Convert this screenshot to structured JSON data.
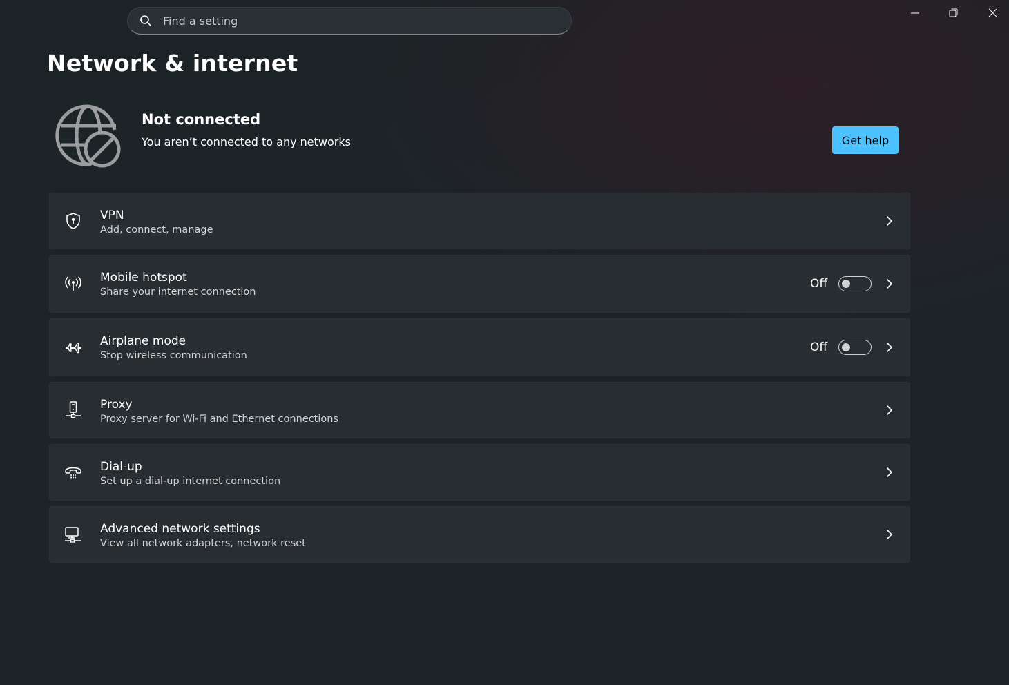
{
  "search": {
    "placeholder": "Find a setting",
    "icon": "search-icon"
  },
  "window_controls": {
    "minimize_icon": "minimize-icon",
    "restore_icon": "restore-icon",
    "close_icon": "close-icon"
  },
  "page": {
    "title": "Network & internet"
  },
  "status": {
    "icon": "globe-blocked-icon",
    "title": "Not connected",
    "subtitle": "You aren’t connected to any networks",
    "help_label": "Get help"
  },
  "accent_color": "#4cc2ff",
  "items": [
    {
      "icon": "vpn-shield-icon",
      "title": "VPN",
      "subtitle": "Add, connect, manage"
    },
    {
      "icon": "hotspot-icon",
      "title": "Mobile hotspot",
      "subtitle": "Share your internet connection",
      "toggle_label": "Off",
      "toggle_on": false
    },
    {
      "icon": "airplane-icon",
      "title": "Airplane mode",
      "subtitle": "Stop wireless communication",
      "toggle_label": "Off",
      "toggle_on": false
    },
    {
      "icon": "proxy-icon",
      "title": "Proxy",
      "subtitle": "Proxy server for Wi-Fi and Ethernet connections"
    },
    {
      "icon": "dial-up-icon",
      "title": "Dial-up",
      "subtitle": "Set up a dial-up internet connection"
    },
    {
      "icon": "network-adapter-icon",
      "title": "Advanced network settings",
      "subtitle": "View all network adapters, network reset"
    }
  ]
}
